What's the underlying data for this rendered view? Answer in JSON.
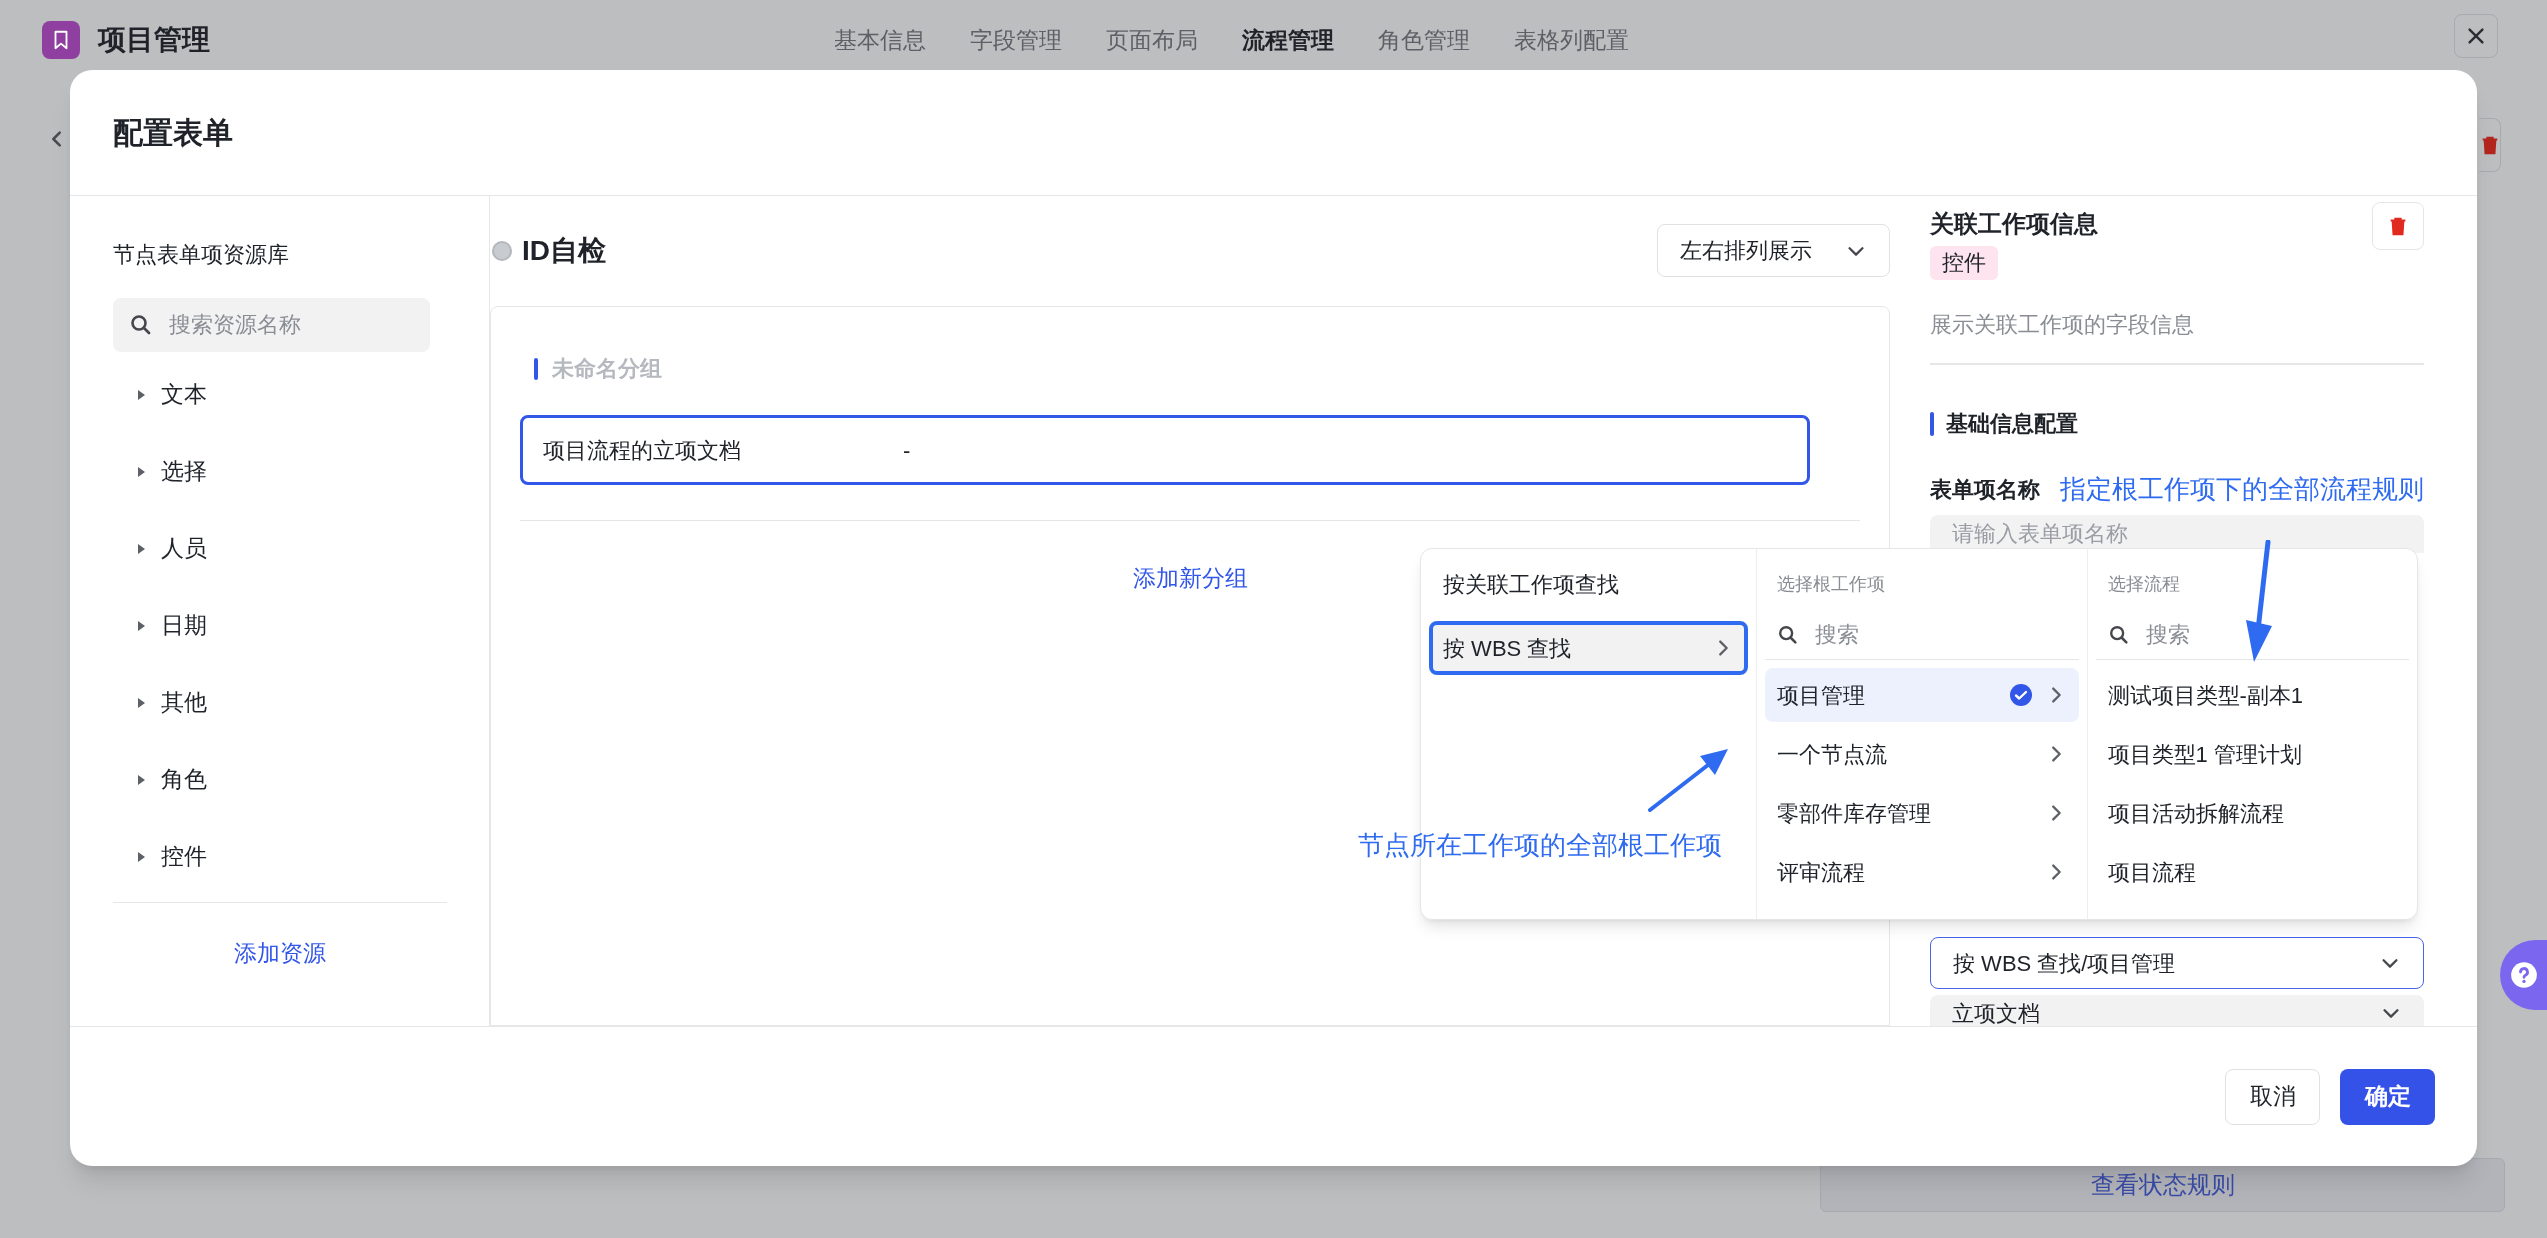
{
  "app": {
    "title": "项目管理"
  },
  "nav_tabs": [
    {
      "label": "基本信息",
      "selected": false
    },
    {
      "label": "字段管理",
      "selected": false
    },
    {
      "label": "页面布局",
      "selected": false
    },
    {
      "label": "流程管理",
      "selected": true
    },
    {
      "label": "角色管理",
      "selected": false
    },
    {
      "label": "表格列配置",
      "selected": false
    }
  ],
  "background": {
    "view_rules_button": "查看状态规则"
  },
  "modal": {
    "title": "配置表单",
    "resource_library": {
      "title": "节点表单项资源库",
      "search": {
        "placeholder": "搜索资源名称"
      },
      "categories": [
        {
          "label": "文本",
          "expanded": false
        },
        {
          "label": "选择",
          "expanded": false
        },
        {
          "label": "人员",
          "expanded": false
        },
        {
          "label": "日期",
          "expanded": false
        },
        {
          "label": "其他",
          "expanded": false
        },
        {
          "label": "角色",
          "expanded": false
        },
        {
          "label": "控件",
          "expanded": false
        }
      ],
      "add_button": "添加资源"
    },
    "form": {
      "id_check": {
        "label": "ID自检",
        "checked": false
      },
      "layout_select": "左右排列展示",
      "groups": [
        {
          "title": "未命名分组",
          "fields": [
            {
              "label": "项目流程的立项文档",
              "value": "-",
              "selected": true
            }
          ]
        }
      ],
      "add_group": "添加新分组"
    },
    "properties": {
      "title": "关联工作项信息",
      "tag": "控件",
      "description": "展示关联工作项的字段信息",
      "section": "基础信息配置",
      "name_field": {
        "label": "表单项名称",
        "placeholder": "请输入表单项名称"
      },
      "source_select": "按 WBS 查找/项目管理",
      "document_select": "立项文档"
    },
    "cascader": {
      "modes": [
        {
          "label": "按关联工作项查找",
          "selected": false
        },
        {
          "label": "按 WBS 查找",
          "selected": true
        }
      ],
      "root_column": {
        "header": "选择根工作项",
        "search": {
          "placeholder": "搜索"
        },
        "items": [
          {
            "label": "项目管理",
            "selected": true
          },
          {
            "label": "一个节点流",
            "selected": false
          },
          {
            "label": "零部件库存管理",
            "selected": false
          },
          {
            "label": "评审流程",
            "selected": false
          }
        ]
      },
      "flow_column": {
        "header": "选择流程",
        "search": {
          "placeholder": "搜索"
        },
        "items": [
          {
            "label": "测试项目类型-副本1",
            "selected": false
          },
          {
            "label": "项目类型1 管理计划",
            "selected": false
          },
          {
            "label": "项目活动拆解流程",
            "selected": false
          },
          {
            "label": "项目流程",
            "selected": false
          }
        ]
      }
    },
    "buttons": {
      "cancel": "取消",
      "confirm": "确定"
    }
  },
  "annotations": [
    {
      "text": "节点所在工作项的全部根工作项"
    },
    {
      "text": "指定根工作项下的全部流程规则"
    }
  ]
}
